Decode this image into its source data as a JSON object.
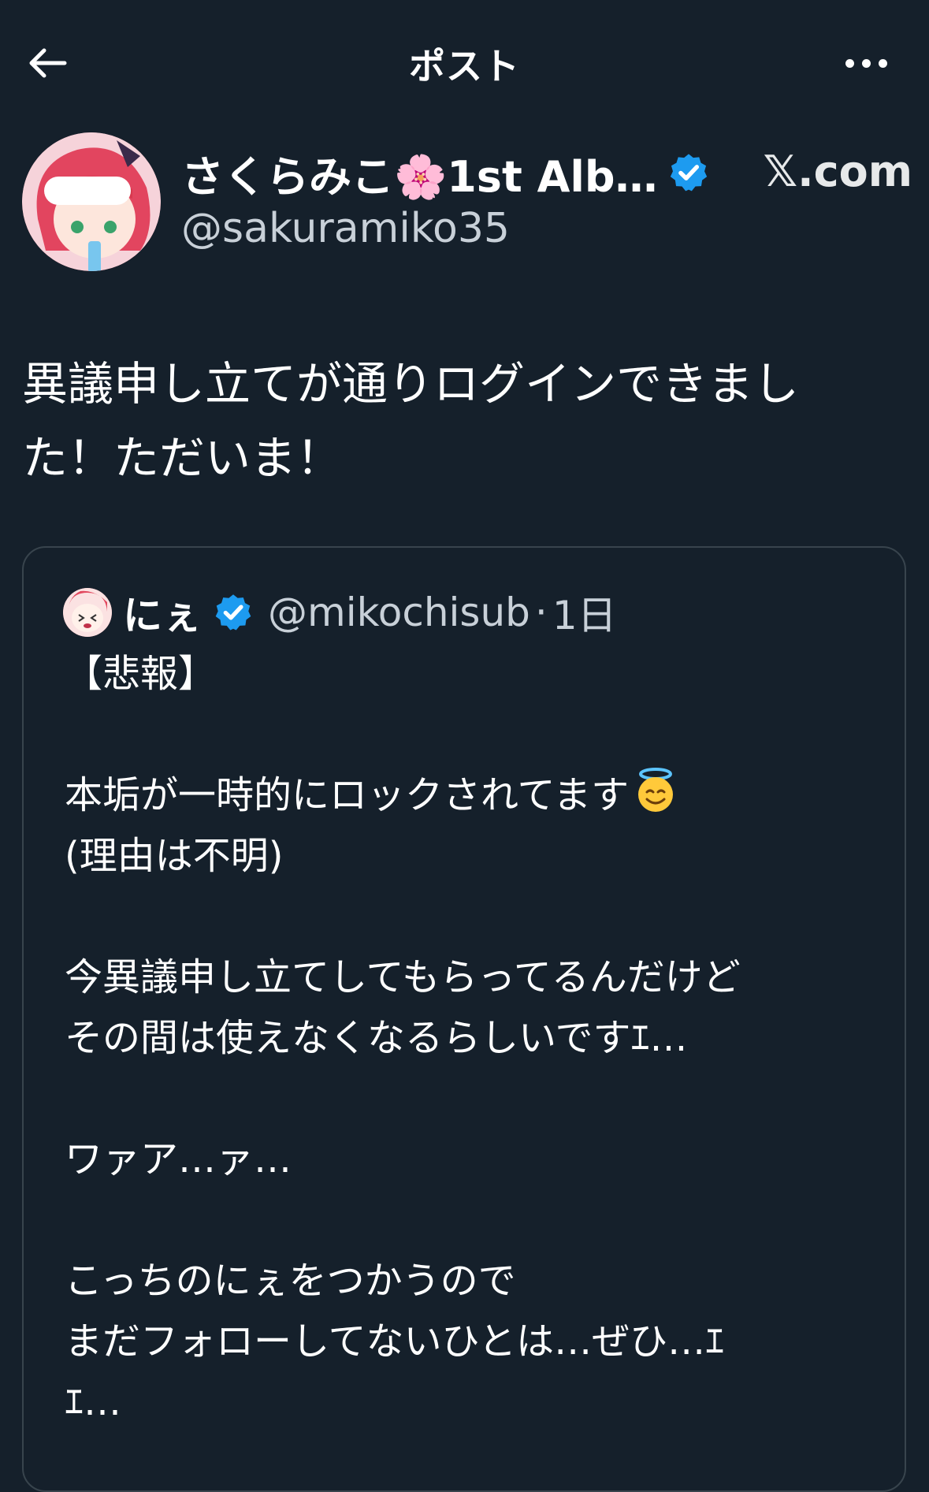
{
  "topbar": {
    "title": "ポスト"
  },
  "author": {
    "name": "さくらみこ🌸1st Alb…",
    "handle": "@sakuramiko35",
    "brand": "𝕏.com"
  },
  "post": {
    "text": "異議申し立てが通りログインできまし\nた！ただいま！"
  },
  "quote": {
    "name": "にぇ",
    "handle": "@mikochisub",
    "separator": "·",
    "time": "1日",
    "lines": [
      "【悲報】",
      "",
      "本垢が一時的にロックされてます",
      "(理由は不明)",
      "",
      "今異議申し立てしてもらってるんだけど",
      "その間は使えなくなるらしいですｴ…",
      "",
      "ワァア…ァ…",
      "",
      "こっちのにぇをつかうので",
      "まだフォローしてないひとは…ぜひ…ｴ",
      "ｴ…"
    ]
  },
  "colors": {
    "background": "#15202b",
    "text": "#ffffff",
    "secondary": "#c8d0d8",
    "verified": "#1d9bf0",
    "border": "#38444d"
  },
  "icons": {
    "back": "arrow-left-icon",
    "more": "more-horizontal-icon",
    "verified": "verified-badge-icon",
    "halo_emoji": "smiling-face-with-halo-emoji"
  }
}
